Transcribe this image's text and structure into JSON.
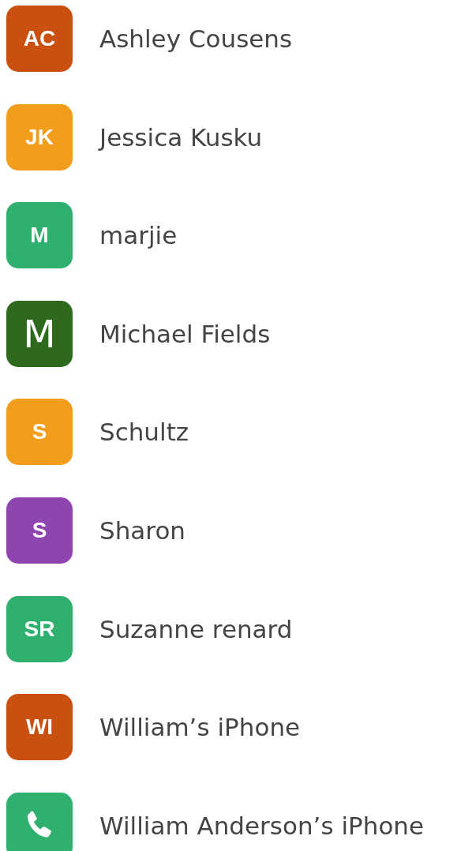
{
  "contacts": [
    {
      "name": "Ashley Cousens",
      "avatar": {
        "kind": "initials",
        "text": "AC",
        "color": "#ca5010"
      }
    },
    {
      "name": "Jessica Kusku",
      "avatar": {
        "kind": "initials",
        "text": "JK",
        "color": "#f29d1c"
      }
    },
    {
      "name": "marjie",
      "avatar": {
        "kind": "initials",
        "text": "M",
        "color": "#2fb06e"
      }
    },
    {
      "name": "Michael Fields",
      "avatar": {
        "kind": "letter",
        "text": "M",
        "color": "#2d6a1e"
      }
    },
    {
      "name": "Schultz",
      "avatar": {
        "kind": "initials",
        "text": "S",
        "color": "#f29d1c"
      }
    },
    {
      "name": "Sharon",
      "avatar": {
        "kind": "initials",
        "text": "S",
        "color": "#8e45b0"
      }
    },
    {
      "name": "Suzanne renard",
      "avatar": {
        "kind": "initials",
        "text": "SR",
        "color": "#2fb06e"
      }
    },
    {
      "name": "William’s iPhone",
      "avatar": {
        "kind": "initials",
        "text": "WI",
        "color": "#ca5010"
      }
    },
    {
      "name": "William Anderson’s iPhone",
      "avatar": {
        "kind": "phone",
        "color": "#2fb06e"
      }
    }
  ]
}
